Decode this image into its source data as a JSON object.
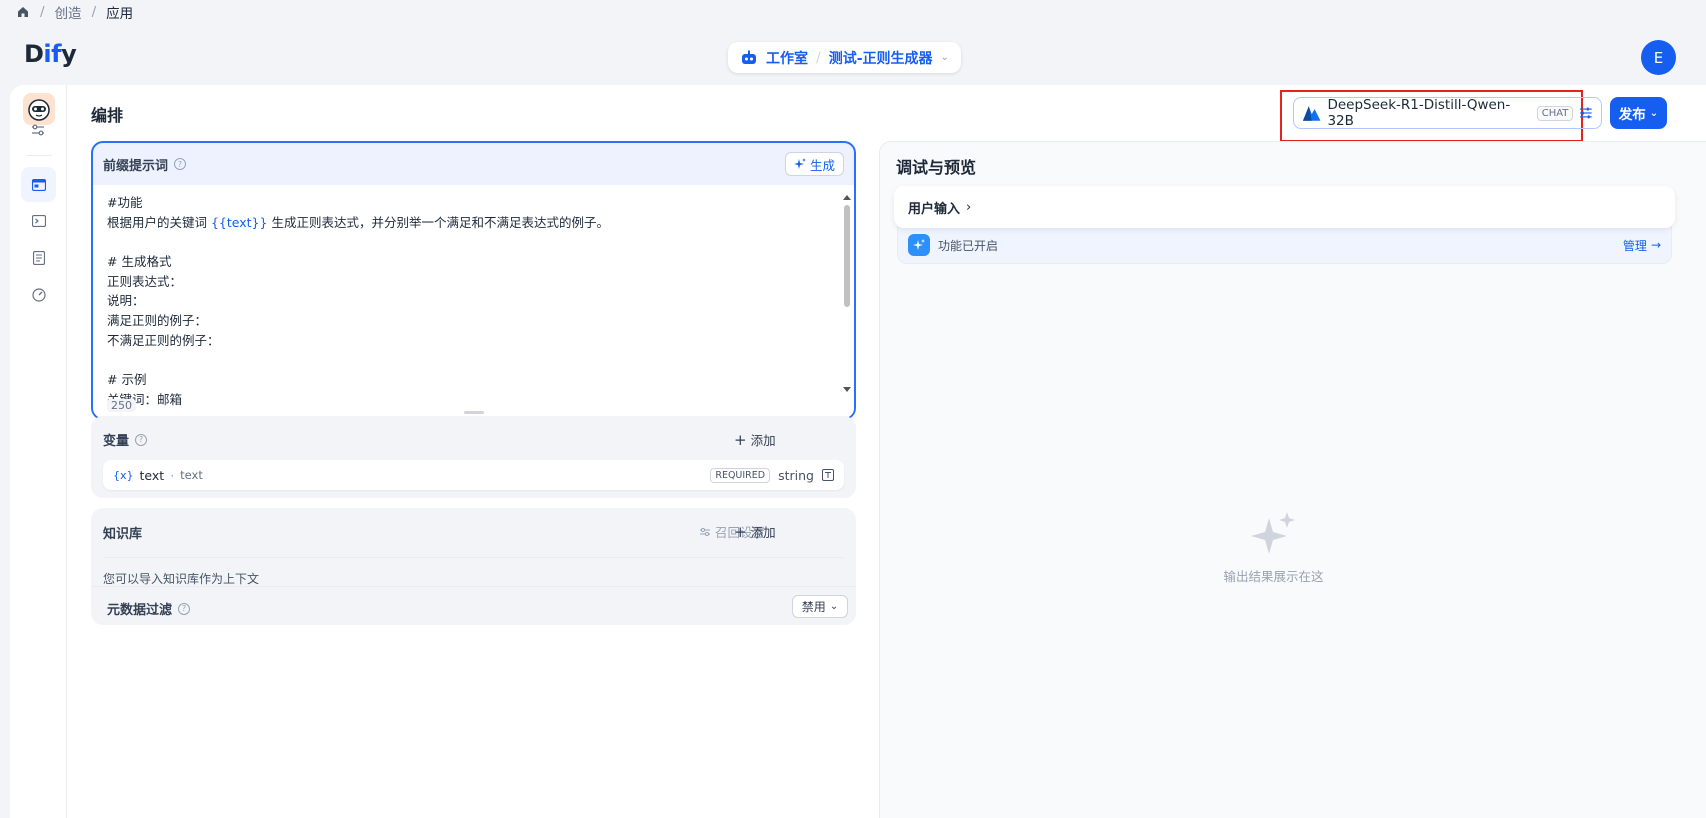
{
  "breadcrumb": {
    "items": [
      "创造",
      "应用"
    ]
  },
  "header": {
    "logo_prefix": "D",
    "logo_accent": "if",
    "logo_suffix": "y",
    "workspace": "工作室",
    "app_name": "测试-正则生成器",
    "avatar_letter": "E"
  },
  "page": {
    "title": "编排",
    "model_name": "DeepSeek-R1-Distill-Qwen-32B",
    "model_badge": "CHAT",
    "publish_label": "发布"
  },
  "prompt": {
    "label": "前缀提示词",
    "generate_label": "生成",
    "lines": [
      "#功能",
      "根据用户的关键词 {{text}} 生成正则表达式，并分别举一个满足和不满足表达式的例子。",
      "",
      "# 生成格式",
      "正则表达式：",
      "说明：",
      "满足正则的例子：",
      "不满足正则的例子：",
      "",
      "# 示例",
      "关键词：邮箱"
    ],
    "line2_before": "根据用户的关键词 ",
    "line2_var": "{{text}}",
    "line2_after": " 生成正则表达式，并分别举一个满足和不满足表达式的例子。",
    "char_count": "250"
  },
  "variables": {
    "label": "变量",
    "add_label": "添加",
    "items": [
      {
        "icon_text": "{x}",
        "name": "text",
        "display": "text",
        "required": "REQUIRED",
        "type": "string"
      }
    ]
  },
  "knowledge": {
    "label": "知识库",
    "recall_label": "召回设置",
    "add_label": "添加",
    "description": "您可以导入知识库作为上下文",
    "filter_label": "元数据过滤",
    "filter_value": "禁用"
  },
  "preview": {
    "title": "调试与预览",
    "user_input_label": "用户输入",
    "feature_label": "功能已开启",
    "manage_label": "管理",
    "empty_text": "输出结果展示在这"
  },
  "colors": {
    "accent": "#155eef",
    "highlight_box": "#e5231b"
  }
}
